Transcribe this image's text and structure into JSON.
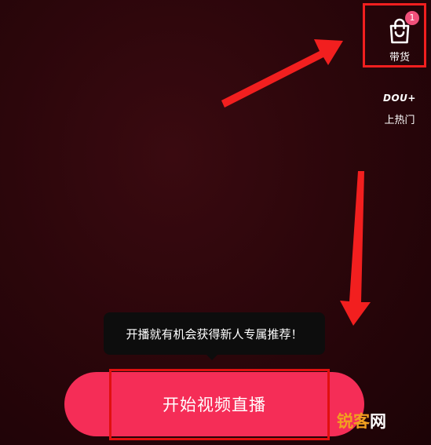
{
  "side_tools": {
    "shop": {
      "label": "带货",
      "badge_count": "1",
      "icon": "shopping-bag-icon"
    },
    "dou": {
      "logo_text": "DOU+",
      "label": "上热门"
    }
  },
  "tooltip": {
    "text": "开播就有机会获得新人专属推荐！"
  },
  "start_button": {
    "label": "开始视频直播"
  },
  "watermark": {
    "part1": "锐",
    "part2": "客",
    "part3": "网"
  },
  "colors": {
    "background": "#2c060b",
    "button": "#f52d57",
    "badge": "#f0507a",
    "annotation_red": "#f21f1f",
    "tooltip_bg": "#0d0d0d",
    "watermark_orange": "#f0a020"
  }
}
